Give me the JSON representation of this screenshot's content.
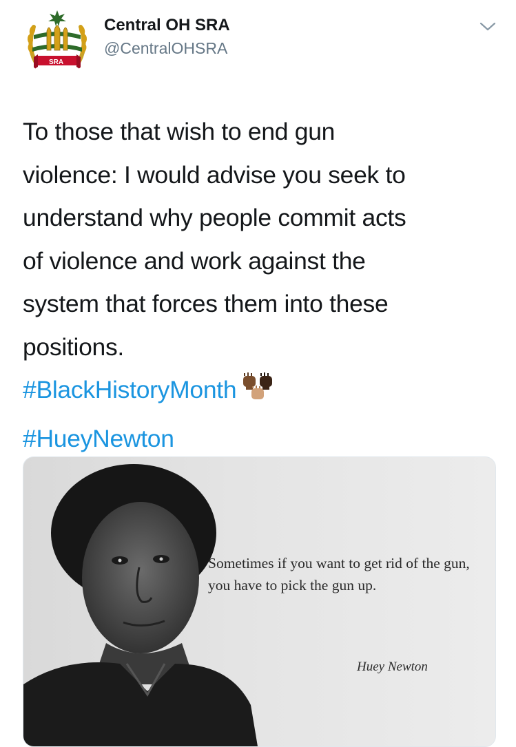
{
  "account": {
    "display_name": "Central OH SRA",
    "handle": "@CentralOHSRA",
    "avatar_badge": "SRA"
  },
  "tweet": {
    "lines": [
      "To those that wish to end gun",
      "violence: I would advise you seek to",
      "understand why people commit acts",
      "of violence and work against the",
      "system that forces them into these",
      "positions."
    ],
    "hashtags": [
      "#BlackHistoryMonth",
      "#HueyNewton"
    ],
    "emoji": "raised-fists-emoji"
  },
  "media": {
    "quote": "Sometimes if you want to get rid of the gun, you have to pick the gun up.",
    "author": "Huey Newton"
  },
  "colors": {
    "hashtag": "#1b95e0",
    "text": "#14171a",
    "handle": "#657786",
    "avatar_green": "#2e6b2a",
    "avatar_red": "#c8102e",
    "avatar_gold": "#d4a017"
  },
  "icons": {
    "menu": "chevron-down-icon",
    "avatar": "sra-emblem-logo"
  }
}
